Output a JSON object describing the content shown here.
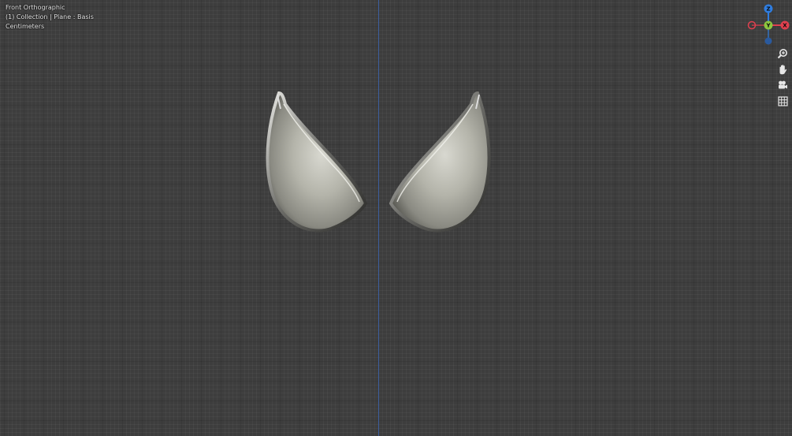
{
  "viewport": {
    "view_name": "Front Orthographic",
    "collection_info": "(1) Collection | Plane : Basis",
    "units": "Centimeters"
  },
  "gizmo": {
    "z_label": "Z",
    "y_label": "Y",
    "x_label": "X",
    "colors": {
      "z": "#2f7de0",
      "y": "#8cc63f",
      "x": "#e0404f"
    }
  },
  "nav_buttons": [
    {
      "name": "zoom",
      "icon": "zoom-icon"
    },
    {
      "name": "pan",
      "icon": "hand-icon"
    },
    {
      "name": "camera",
      "icon": "camera-icon"
    },
    {
      "name": "ortho-toggle",
      "icon": "grid-icon"
    }
  ],
  "colors": {
    "background": "#3d3d3d",
    "z_axis_line": "#3d5f9e"
  }
}
